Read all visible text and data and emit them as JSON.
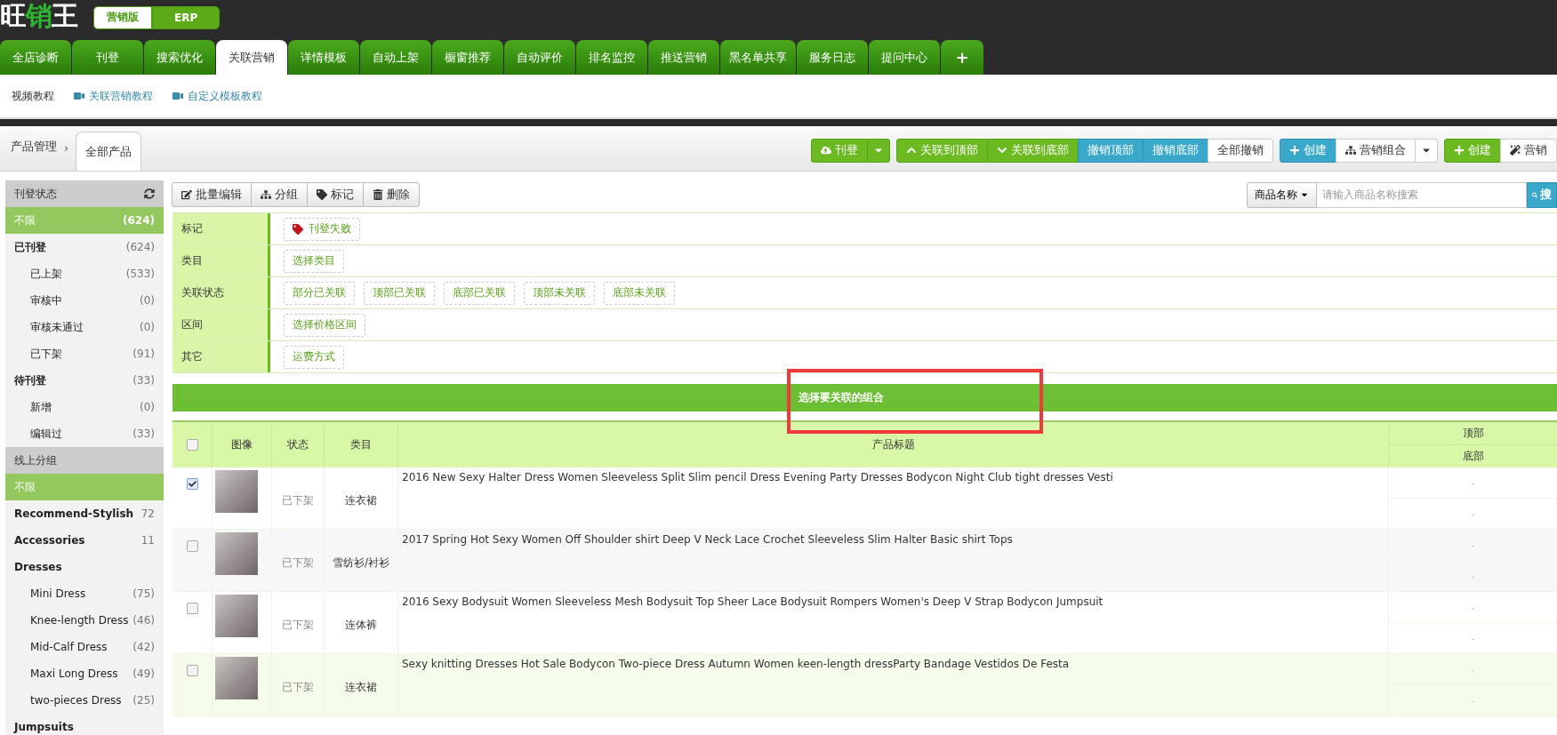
{
  "header": {
    "logo": [
      {
        "text": "旺",
        "kind": "plain"
      },
      {
        "text": "销",
        "kind": "accent"
      },
      {
        "text": "王",
        "kind": "plain"
      }
    ],
    "editions": [
      {
        "label": "营销版",
        "selected": true
      },
      {
        "label": "ERP",
        "selected": false
      }
    ]
  },
  "main_tabs": [
    {
      "label": "全店诊断",
      "selected": false
    },
    {
      "label": "刊登",
      "selected": false
    },
    {
      "label": "搜索优化",
      "selected": false
    },
    {
      "label": "关联营销",
      "selected": true
    },
    {
      "label": "详情模板",
      "selected": false
    },
    {
      "label": "自动上架",
      "selected": false
    },
    {
      "label": "橱窗推荐",
      "selected": false
    },
    {
      "label": "自动评价",
      "selected": false
    },
    {
      "label": "排名监控",
      "selected": false
    },
    {
      "label": "推送营销",
      "selected": false
    },
    {
      "label": "黑名单共享",
      "selected": false
    },
    {
      "label": "服务日志",
      "selected": false
    },
    {
      "label": "提问中心",
      "selected": false
    },
    {
      "label": "+",
      "selected": false
    }
  ],
  "video_bar": {
    "label": "视频教程",
    "links": [
      "关联营销教程",
      "自定义模板教程"
    ]
  },
  "breadcrumb": {
    "root": "产品管理",
    "separator": "›",
    "current": "全部产品"
  },
  "actions": [
    {
      "kind": "green",
      "label": "刊登",
      "caret": true
    },
    {
      "kind": "green",
      "label": "关联到顶部"
    },
    {
      "kind": "green",
      "label": "关联到底部"
    },
    {
      "kind": "blue",
      "label": "撤销顶部"
    },
    {
      "kind": "blue",
      "label": "撤销底部"
    },
    {
      "kind": "white",
      "label": "全部撤销"
    },
    {
      "kind": "blue",
      "label": "创建"
    },
    {
      "kind": "white",
      "label": "营销组合",
      "caret": true
    },
    {
      "kind": "green",
      "label": "创建"
    },
    {
      "kind": "white",
      "label": "营销"
    }
  ],
  "sidebar": {
    "sections": [
      {
        "title": "刊登状态",
        "refresh": true,
        "items": [
          {
            "label": "不限",
            "count": "(624)",
            "selected": true,
            "bold": false
          },
          {
            "label": "已刊登",
            "count": "(624)",
            "selected": false,
            "bold": true,
            "children": [
              {
                "label": "已上架",
                "count": "(533)",
                "selected": false
              },
              {
                "label": "审核中",
                "count": "(0)",
                "selected": false
              },
              {
                "label": "审核未通过",
                "count": "(0)",
                "selected": false
              },
              {
                "label": "已下架",
                "count": "(91)",
                "selected": false
              }
            ]
          },
          {
            "label": "待刊登",
            "count": "(33)",
            "selected": false,
            "bold": true,
            "children": [
              {
                "label": "新增",
                "count": "(0)",
                "selected": false
              },
              {
                "label": "编辑过",
                "count": "(33)",
                "selected": false
              }
            ]
          }
        ]
      },
      {
        "title": "线上分组",
        "refresh": false,
        "items": [
          {
            "label": "不限",
            "selected": true,
            "bold": false
          },
          {
            "label": "Recommend-Stylish",
            "count": "72",
            "selected": false,
            "bold": true
          },
          {
            "label": "Accessories",
            "count": "11",
            "selected": false,
            "bold": true
          },
          {
            "label": "Dresses",
            "selected": false,
            "bold": true,
            "children": [
              {
                "label": "Mini Dress",
                "count": "(75)",
                "selected": false
              },
              {
                "label": "Knee-length Dress",
                "count": "(46)",
                "selected": false
              },
              {
                "label": "Mid-Calf Dress",
                "count": "(42)",
                "selected": false
              },
              {
                "label": "Maxi Long Dress",
                "count": "(49)",
                "selected": false
              },
              {
                "label": "two-pieces Dress",
                "count": "(25)",
                "selected": false
              }
            ]
          },
          {
            "label": "Jumpsuits",
            "selected": false,
            "bold": true
          }
        ]
      }
    ]
  },
  "toolbar": [
    "批量编辑",
    "分组",
    "标记",
    "删除"
  ],
  "search": {
    "field": "商品名称",
    "placeholder": "请输入商品名称搜索",
    "button": "搜"
  },
  "filters": [
    {
      "label": "标记",
      "options": [
        {
          "text": "刊登失败",
          "tag": true
        }
      ]
    },
    {
      "label": "类目",
      "options": [
        {
          "text": "选择类目"
        }
      ]
    },
    {
      "label": "关联状态",
      "options": [
        {
          "text": "部分已关联"
        },
        {
          "text": "顶部已关联"
        },
        {
          "text": "底部已关联"
        },
        {
          "text": "顶部未关联"
        },
        {
          "text": "底部未关联"
        }
      ]
    },
    {
      "label": "区间",
      "options": [
        {
          "text": "选择价格区间"
        }
      ]
    },
    {
      "label": "其它",
      "options": [
        {
          "text": "运费方式"
        }
      ]
    }
  ],
  "combo_bar": {
    "label": "选择要关联的组合",
    "highlighted": true
  },
  "table": {
    "columns": [
      "图像",
      "状态",
      "类目",
      "产品标题"
    ],
    "position_column": [
      "顶部",
      "底部"
    ],
    "all_checked": false,
    "rows": [
      {
        "checked": true,
        "status": "已下架",
        "category": "连衣裙",
        "title": "2016 New Sexy Halter Dress Women Sleeveless Split Slim pencil Dress Evening Party Dresses Bodycon Night Club tight dresses Vesti",
        "top": "-",
        "bottom": "-"
      },
      {
        "checked": false,
        "status": "已下架",
        "category": "雪纺衫/衬衫",
        "title": "2017 Spring Hot Sexy Women Off Shoulder shirt Deep V Neck Lace Crochet Sleeveless Slim Halter Basic shirt Tops",
        "top": "-",
        "bottom": "-"
      },
      {
        "checked": false,
        "status": "已下架",
        "category": "连体裤",
        "title": "2016 Sexy Bodysuit Women Sleeveless Mesh Bodysuit Top Sheer Lace Bodysuit Rompers Women's Deep V Strap Bodycon Jumpsuit",
        "top": "-",
        "bottom": "-"
      },
      {
        "checked": false,
        "status": "已下架",
        "category": "连衣裙",
        "title": "Sexy knitting Dresses Hot Sale Bodycon Two-piece Dress Autumn Women keen-length dressParty Bandage Vestidos De Festa",
        "top": "-",
        "bottom": "-"
      }
    ]
  }
}
